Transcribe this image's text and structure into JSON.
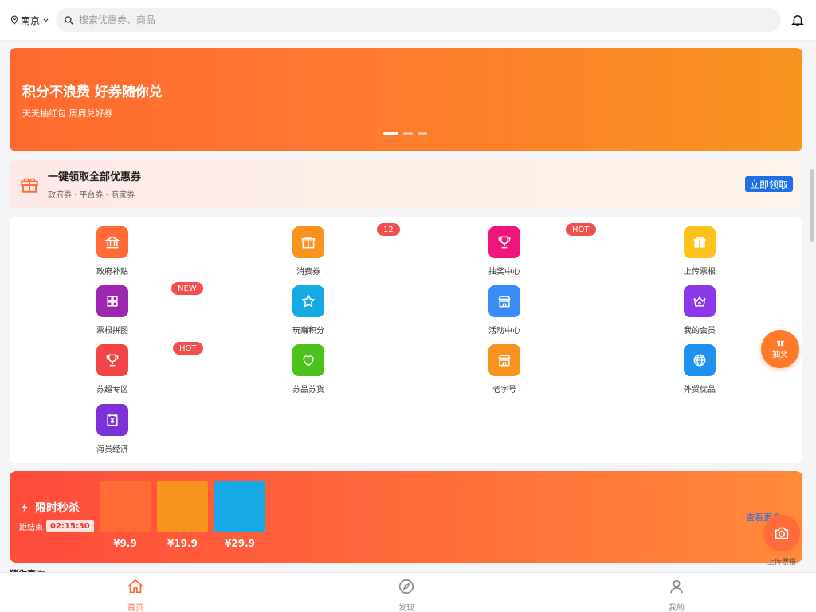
{
  "header": {
    "city": "南京",
    "search_placeholder": "搜索优惠券、商品",
    "icons": [
      "location-pin-icon",
      "chevron-down-icon",
      "search-icon",
      "bell-icon"
    ]
  },
  "banner": {
    "title": "积分不浪费 好券随你兑",
    "subtitle": "天天抽红包 周周兑好券",
    "slide_count": 3,
    "active_slide": 1
  },
  "claim_bar": {
    "title": "一键领取全部优惠券",
    "subtitle": "政府券 · 平台券 · 商家券",
    "button": "立即领取",
    "icon": "gift-icon"
  },
  "grid": {
    "items": [
      {
        "label": "政府补贴",
        "icon": "bank-icon",
        "color": "#ff6a35"
      },
      {
        "label": "消费券",
        "icon": "gift-icon",
        "color": "#f7931e"
      },
      {
        "label": "抽奖中心",
        "icon": "trophy-icon",
        "color": "#f0157a"
      },
      {
        "label": "上传票根",
        "icon": "gift-box-icon",
        "color": "#ffc21a"
      },
      {
        "label": "票根拼图",
        "icon": "grid-icon",
        "color": "#9c27b0"
      },
      {
        "label": "玩赚积分",
        "icon": "star-icon",
        "color": "#17a9e6"
      },
      {
        "label": "活动中心",
        "icon": "store-icon",
        "color": "#3a8bf5"
      },
      {
        "label": "我的会员",
        "icon": "crown-icon",
        "color": "#8a38e8"
      },
      {
        "label": "苏超专区",
        "icon": "trophy-icon",
        "color": "#f24545"
      },
      {
        "label": "苏品苏货",
        "icon": "heart-icon",
        "color": "#4cc21c"
      },
      {
        "label": "老字号",
        "icon": "store-icon",
        "color": "#f7931e"
      },
      {
        "label": "外贸优品",
        "icon": "globe-icon",
        "color": "#1e90f0"
      },
      {
        "label": "海员经济",
        "icon": "yen-calendar-icon",
        "color": "#7b32d6"
      }
    ],
    "badges": [
      "12",
      "HOT",
      "NEW",
      "HOT"
    ]
  },
  "flash_sale": {
    "title": "限时秒杀",
    "ends_label": "距结束",
    "countdown": "02:15:30",
    "more": "查看更多 ›",
    "products": [
      {
        "price": "¥9.9",
        "color": "#ff6a35"
      },
      {
        "price": "¥19.9",
        "color": "#f7931e"
      },
      {
        "price": "¥29.9",
        "color": "#17a9e6"
      }
    ],
    "icon": "lightning-icon"
  },
  "section_peek": "猜你喜欢",
  "fab": {
    "draw_label": "抽奖",
    "upload_label": "上传票根"
  },
  "bottom_nav": {
    "items": [
      {
        "label": "首页",
        "icon": "home-icon",
        "active": true
      },
      {
        "label": "发现",
        "icon": "compass-icon",
        "active": false
      },
      {
        "label": "我的",
        "icon": "user-icon",
        "active": false
      }
    ]
  },
  "colors": {
    "accent": "#ff6a2f",
    "primary_button": "#1d6fe3",
    "badge": "#f24e4e",
    "link": "#2f6fe0"
  }
}
